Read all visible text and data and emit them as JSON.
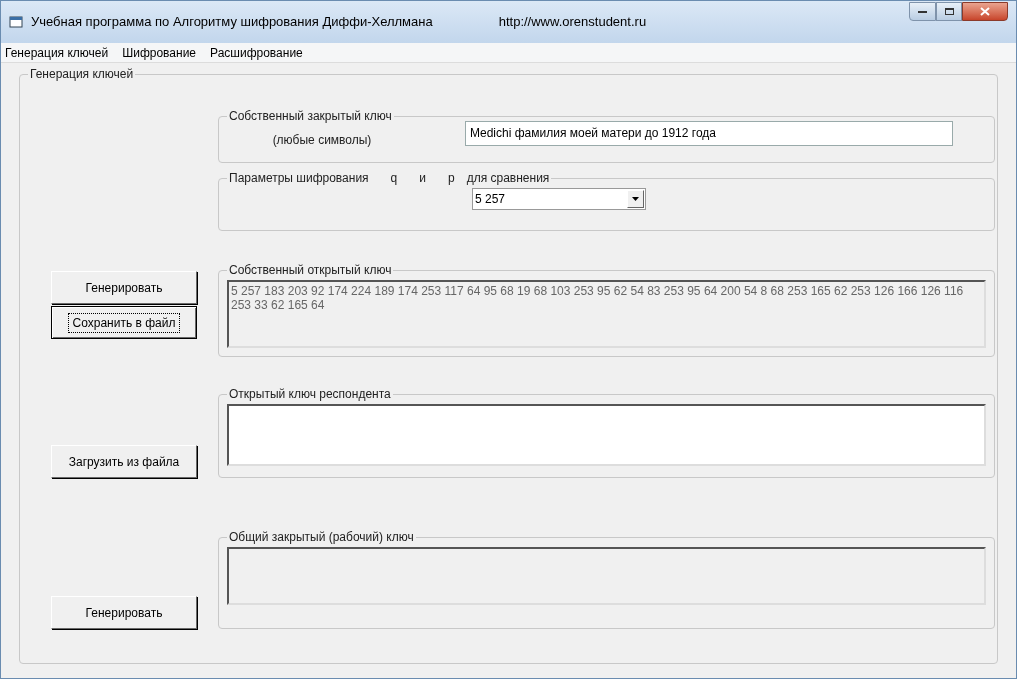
{
  "window": {
    "title": "Учебная программа по Алгоритму шифрования Диффи-Хеллмана",
    "url": "http://www.orenstudent.ru"
  },
  "menu": [
    "Генерация ключей",
    "Шифрование",
    "Расшифрование"
  ],
  "group_title": "Генерация ключей",
  "private_key": {
    "title": "Собственный закрытый ключ",
    "hint": "(любые символы)",
    "value": "Medichi фамилия моей матери до 1912 года"
  },
  "params": {
    "title": "Параметры шифрования",
    "labels": [
      "q",
      "и",
      "p",
      "для сравнения"
    ],
    "value": "5 257"
  },
  "sections": [
    {
      "title": "Собственный открытый ключ",
      "readonly": true,
      "value": "5 257 183 203 92 174 224 189 174 253 117 64 95 68 19 68 103 253 95 62 54 83 253 95 64 200 54 8 68 253 165 62 253 126 166 126 116 253 33 62 165 64",
      "buttons": [
        {
          "label": "Генерировать",
          "focused": false
        },
        {
          "label": "Сохранить в файл",
          "focused": true
        }
      ]
    },
    {
      "title": "Открытый ключ респондента",
      "readonly": false,
      "buttons": [
        {
          "label": "Загрузить из файла",
          "focused": false
        }
      ]
    },
    {
      "title": "Общий закрытый (рабочий) ключ",
      "readonly": true,
      "buttons": [
        {
          "label": "Генерировать",
          "focused": false
        }
      ]
    }
  ]
}
